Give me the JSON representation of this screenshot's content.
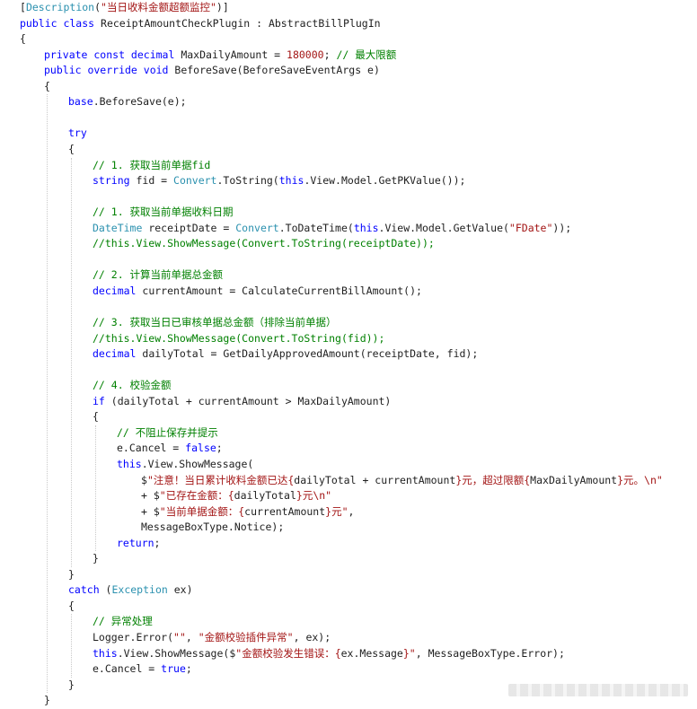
{
  "theme": {
    "background": "#ffffff",
    "keyword": "#0000ff",
    "type": "#2b91af",
    "string": "#a31515",
    "comment": "#008000",
    "plain": "#1e1e1e"
  },
  "code_lines": [
    {
      "indent": 0,
      "tokens": [
        {
          "t": "[",
          "c": "plain"
        },
        {
          "t": "Description",
          "c": "attr"
        },
        {
          "t": "(",
          "c": "plain"
        },
        {
          "t": "\"当日收料金额超额监控\"",
          "c": "str"
        },
        {
          "t": ")]",
          "c": "plain"
        }
      ]
    },
    {
      "indent": 0,
      "tokens": [
        {
          "t": "public class ",
          "c": "kw"
        },
        {
          "t": "ReceiptAmountCheckPlugin : AbstractBillPlugIn",
          "c": "plain"
        }
      ]
    },
    {
      "indent": 0,
      "tokens": [
        {
          "t": "{",
          "c": "plain"
        }
      ]
    },
    {
      "indent": 1,
      "tokens": [
        {
          "t": "private const decimal ",
          "c": "kw"
        },
        {
          "t": "MaxDailyAmount = ",
          "c": "plain"
        },
        {
          "t": "180000",
          "c": "num"
        },
        {
          "t": "; ",
          "c": "plain"
        },
        {
          "t": "// 最大限额",
          "c": "com"
        }
      ]
    },
    {
      "indent": 1,
      "tokens": [
        {
          "t": "public override void ",
          "c": "kw"
        },
        {
          "t": "BeforeSave(BeforeSaveEventArgs e)",
          "c": "plain"
        }
      ]
    },
    {
      "indent": 1,
      "tokens": [
        {
          "t": "{",
          "c": "plain"
        }
      ]
    },
    {
      "indent": 2,
      "tokens": [
        {
          "t": "base",
          "c": "kw"
        },
        {
          "t": ".BeforeSave(e);",
          "c": "plain"
        }
      ]
    },
    {
      "indent": 2,
      "tokens": []
    },
    {
      "indent": 2,
      "tokens": [
        {
          "t": "try",
          "c": "kw"
        }
      ]
    },
    {
      "indent": 2,
      "tokens": [
        {
          "t": "{",
          "c": "plain"
        }
      ]
    },
    {
      "indent": 3,
      "tokens": [
        {
          "t": "// 1. 获取当前单据fid",
          "c": "com"
        }
      ]
    },
    {
      "indent": 3,
      "tokens": [
        {
          "t": "string ",
          "c": "kw"
        },
        {
          "t": "fid = ",
          "c": "plain"
        },
        {
          "t": "Convert",
          "c": "type"
        },
        {
          "t": ".ToString(",
          "c": "plain"
        },
        {
          "t": "this",
          "c": "kw"
        },
        {
          "t": ".View.Model.GetPKValue());",
          "c": "plain"
        }
      ]
    },
    {
      "indent": 3,
      "tokens": []
    },
    {
      "indent": 3,
      "tokens": [
        {
          "t": "// 1. 获取当前单据收料日期",
          "c": "com"
        }
      ]
    },
    {
      "indent": 3,
      "tokens": [
        {
          "t": "DateTime",
          "c": "type"
        },
        {
          "t": " receiptDate = ",
          "c": "plain"
        },
        {
          "t": "Convert",
          "c": "type"
        },
        {
          "t": ".ToDateTime(",
          "c": "plain"
        },
        {
          "t": "this",
          "c": "kw"
        },
        {
          "t": ".View.Model.GetValue(",
          "c": "plain"
        },
        {
          "t": "\"FDate\"",
          "c": "str"
        },
        {
          "t": "));",
          "c": "plain"
        }
      ]
    },
    {
      "indent": 3,
      "tokens": [
        {
          "t": "//this.View.ShowMessage(Convert.ToString(receiptDate));",
          "c": "com"
        }
      ]
    },
    {
      "indent": 3,
      "tokens": []
    },
    {
      "indent": 3,
      "tokens": [
        {
          "t": "// 2. 计算当前单据总金额",
          "c": "com"
        }
      ]
    },
    {
      "indent": 3,
      "tokens": [
        {
          "t": "decimal ",
          "c": "kw"
        },
        {
          "t": "currentAmount = CalculateCurrentBillAmount();",
          "c": "plain"
        }
      ]
    },
    {
      "indent": 3,
      "tokens": []
    },
    {
      "indent": 3,
      "tokens": [
        {
          "t": "// 3. 获取当日已审核单据总金额（排除当前单据）",
          "c": "com"
        }
      ]
    },
    {
      "indent": 3,
      "tokens": [
        {
          "t": "//this.View.ShowMessage(Convert.ToString(fid));",
          "c": "com"
        }
      ]
    },
    {
      "indent": 3,
      "tokens": [
        {
          "t": "decimal ",
          "c": "kw"
        },
        {
          "t": "dailyTotal = GetDailyApprovedAmount(receiptDate, fid);",
          "c": "plain"
        }
      ]
    },
    {
      "indent": 3,
      "tokens": []
    },
    {
      "indent": 3,
      "tokens": [
        {
          "t": "// 4. 校验金额",
          "c": "com"
        }
      ]
    },
    {
      "indent": 3,
      "tokens": [
        {
          "t": "if ",
          "c": "kw"
        },
        {
          "t": "(dailyTotal + currentAmount > MaxDailyAmount)",
          "c": "plain"
        }
      ]
    },
    {
      "indent": 3,
      "tokens": [
        {
          "t": "{",
          "c": "plain"
        }
      ]
    },
    {
      "indent": 4,
      "tokens": [
        {
          "t": "// 不阻止保存并提示",
          "c": "com"
        }
      ]
    },
    {
      "indent": 4,
      "tokens": [
        {
          "t": "e.Cancel = ",
          "c": "plain"
        },
        {
          "t": "false",
          "c": "kw"
        },
        {
          "t": ";",
          "c": "plain"
        }
      ]
    },
    {
      "indent": 4,
      "tokens": [
        {
          "t": "this",
          "c": "kw"
        },
        {
          "t": ".View.ShowMessage(",
          "c": "plain"
        }
      ]
    },
    {
      "indent": 5,
      "tokens": [
        {
          "t": "$",
          "c": "plain"
        },
        {
          "t": "\"注意！当日累计收料金额已达{",
          "c": "str"
        },
        {
          "t": "dailyTotal + currentAmount",
          "c": "plain"
        },
        {
          "t": "}元，超过限额{",
          "c": "str"
        },
        {
          "t": "MaxDailyAmount",
          "c": "plain"
        },
        {
          "t": "}元。\\n\"",
          "c": "str"
        }
      ]
    },
    {
      "indent": 5,
      "tokens": [
        {
          "t": "+ $",
          "c": "plain"
        },
        {
          "t": "\"已存在金额：{",
          "c": "str"
        },
        {
          "t": "dailyTotal",
          "c": "plain"
        },
        {
          "t": "}元\\n\"",
          "c": "str"
        }
      ]
    },
    {
      "indent": 5,
      "tokens": [
        {
          "t": "+ $",
          "c": "plain"
        },
        {
          "t": "\"当前单据金额：{",
          "c": "str"
        },
        {
          "t": "currentAmount",
          "c": "plain"
        },
        {
          "t": "}元\"",
          "c": "str"
        },
        {
          "t": ",",
          "c": "plain"
        }
      ]
    },
    {
      "indent": 5,
      "tokens": [
        {
          "t": "MessageBoxType.Notice);",
          "c": "plain"
        }
      ]
    },
    {
      "indent": 4,
      "tokens": [
        {
          "t": "return",
          "c": "kw"
        },
        {
          "t": ";",
          "c": "plain"
        }
      ]
    },
    {
      "indent": 3,
      "tokens": [
        {
          "t": "}",
          "c": "plain"
        }
      ]
    },
    {
      "indent": 2,
      "tokens": [
        {
          "t": "}",
          "c": "plain"
        }
      ]
    },
    {
      "indent": 2,
      "tokens": [
        {
          "t": "catch ",
          "c": "kw"
        },
        {
          "t": "(",
          "c": "plain"
        },
        {
          "t": "Exception",
          "c": "type"
        },
        {
          "t": " ex)",
          "c": "plain"
        }
      ]
    },
    {
      "indent": 2,
      "tokens": [
        {
          "t": "{",
          "c": "plain"
        }
      ]
    },
    {
      "indent": 3,
      "tokens": [
        {
          "t": "// 异常处理",
          "c": "com"
        }
      ]
    },
    {
      "indent": 3,
      "tokens": [
        {
          "t": "Logger.Error(",
          "c": "plain"
        },
        {
          "t": "\"\"",
          "c": "str"
        },
        {
          "t": ", ",
          "c": "plain"
        },
        {
          "t": "\"金额校验插件异常\"",
          "c": "str"
        },
        {
          "t": ", ex);",
          "c": "plain"
        }
      ]
    },
    {
      "indent": 3,
      "tokens": [
        {
          "t": "this",
          "c": "kw"
        },
        {
          "t": ".View.ShowMessage($",
          "c": "plain"
        },
        {
          "t": "\"金额校验发生错误：{",
          "c": "str"
        },
        {
          "t": "ex.Message",
          "c": "plain"
        },
        {
          "t": "}\"",
          "c": "str"
        },
        {
          "t": ", MessageBoxType.Error);",
          "c": "plain"
        }
      ]
    },
    {
      "indent": 3,
      "tokens": [
        {
          "t": "e.Cancel = ",
          "c": "plain"
        },
        {
          "t": "true",
          "c": "kw"
        },
        {
          "t": ";",
          "c": "plain"
        }
      ]
    },
    {
      "indent": 2,
      "tokens": [
        {
          "t": "}",
          "c": "plain"
        }
      ]
    },
    {
      "indent": 1,
      "tokens": [
        {
          "t": "}",
          "c": "plain"
        }
      ]
    }
  ]
}
